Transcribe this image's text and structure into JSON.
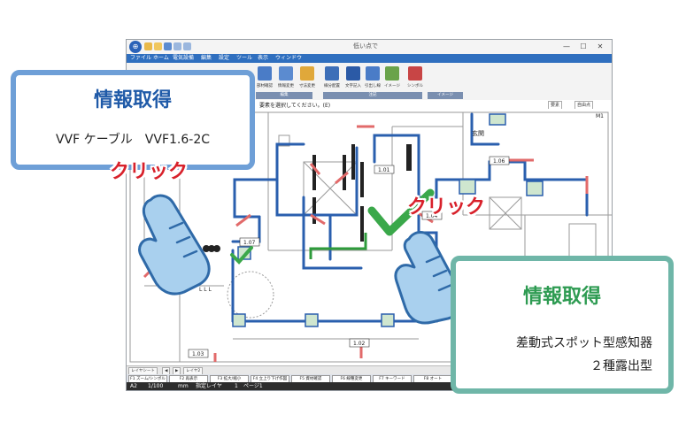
{
  "window": {
    "title": "低い点で",
    "app_logo": "⊕",
    "controls": [
      "—",
      "☐",
      "✕"
    ]
  },
  "menu": [
    "ファイル",
    "ホーム",
    "電気設備",
    "編集",
    "設定",
    "ツール",
    "表示",
    "ウィンドウ"
  ],
  "ribbon": {
    "buttons": [
      {
        "label": "部材確認",
        "color": "#4a7cc7"
      },
      {
        "label": "情報変更",
        "color": "#5b8bd0"
      },
      {
        "label": "寸法変更",
        "color": "#e0a83a"
      },
      {
        "label": "線分配置",
        "color": "#3d6fb8"
      },
      {
        "label": "文字記入",
        "color": "#2b5aa6"
      },
      {
        "label": "引出し線",
        "color": "#4a7cc7"
      },
      {
        "label": "イメージ",
        "color": "#6aa34a"
      },
      {
        "label": "シンボル",
        "color": "#c84545"
      }
    ],
    "groups": [
      "編集",
      "注記",
      "イメージ"
    ]
  },
  "command_line": {
    "prompt": "要素を選択してください。(E)",
    "dropdown1": "要素",
    "dropdown2": "自由点"
  },
  "plan": {
    "room_label": "玄関",
    "tags": [
      "1.01",
      "1.06",
      "1.04",
      "1.07",
      "1.03",
      "1.02"
    ],
    "side_labels": [
      "M1",
      "L L L"
    ]
  },
  "sheet_tabs": [
    "レイヤシート",
    "◀",
    "▶",
    "レイヤ2"
  ],
  "function_keys": [
    "F1 ズーム/シンボル",
    "F2 再表示",
    "F3 拡大/縮小",
    "F4 立上り下げ作図",
    "F5 資材確認",
    "F6 線種変更",
    "F7 キーワード",
    "F8 オート",
    "F9 自由点"
  ],
  "status": {
    "sheet": "A2",
    "scale": "1/100",
    "unit": "mm",
    "layer": "指定レイヤ",
    "page_num": "1",
    "page": "ページ1"
  },
  "callout_left": {
    "title": "情報取得",
    "detail": "VVF ケーブル　VVF1.6-2C"
  },
  "callout_right": {
    "title": "情報取得",
    "detail_line1": "差動式スポット型感知器",
    "detail_line2": "２種露出型"
  },
  "click_label": "クリック",
  "colors": {
    "left_callout_border": "#6e9fd7",
    "left_callout_title": "#1f5aa8",
    "right_callout_border": "#6fb6a8",
    "right_callout_title": "#2e9b52",
    "click_red": "#d8212b",
    "wire_blue": "#2a5fae",
    "wire_green": "#2e9b3b",
    "arrow_red": "#e26a6a",
    "check_green": "#3aa84a",
    "hand_fill": "#a9d0ee"
  }
}
